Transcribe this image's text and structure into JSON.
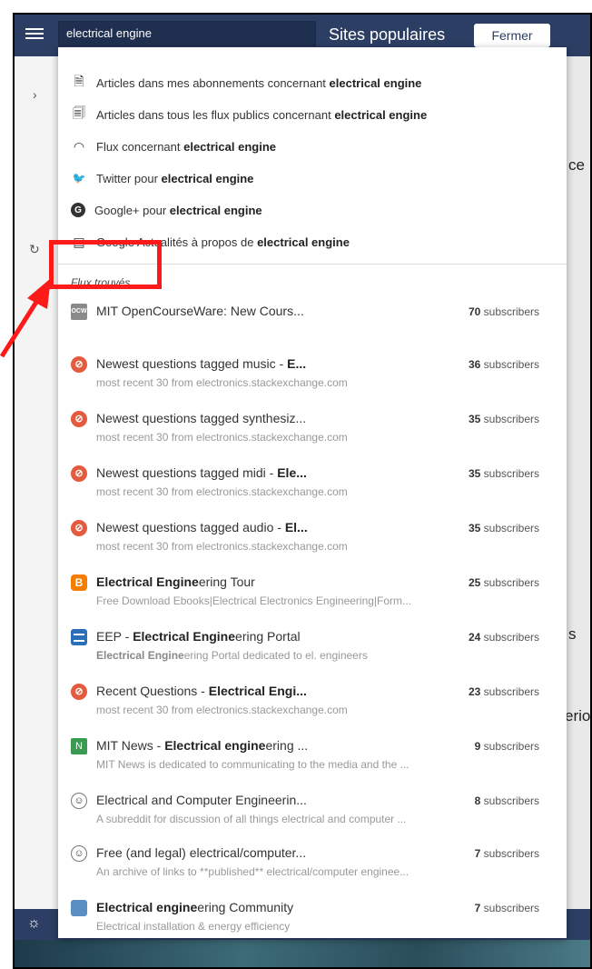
{
  "search": {
    "value": "electrical engine"
  },
  "header": {
    "sites_label": "Sites populaires",
    "close_label": "Fermer"
  },
  "suggestions": [
    {
      "icon": "document-icon",
      "prefix": "Articles dans mes abonnements concernant ",
      "term": "electrical engine"
    },
    {
      "icon": "documents-icon",
      "prefix": "Articles dans tous les flux publics concernant ",
      "term": "electrical engine"
    },
    {
      "icon": "rss-icon",
      "prefix": "Flux concernant ",
      "term": "electrical engine"
    },
    {
      "icon": "twitter-icon",
      "prefix": "Twitter pour ",
      "term": "electrical engine"
    },
    {
      "icon": "google-plus-icon",
      "prefix": "Google+ pour ",
      "term": "electrical engine"
    },
    {
      "icon": "news-icon",
      "prefix": "Google Actualités à propos de ",
      "term": "electrical engine"
    }
  ],
  "flux_label": "Flux trouvés",
  "feeds": [
    {
      "icon": "ocw-icon",
      "title_pre": "MIT OpenCourseWare: New Cours...",
      "title_bold": "",
      "title_post": "",
      "count": "70",
      "count_unit": " subscribers",
      "sub_bold": "",
      "sub": ""
    },
    {
      "icon": "stackexchange-icon",
      "title_pre": "Newest questions tagged music - ",
      "title_bold": "E...",
      "title_post": "",
      "count": "36",
      "count_unit": " subscribers",
      "sub_bold": "",
      "sub": "most recent 30 from electronics.stackexchange.com"
    },
    {
      "icon": "stackexchange-icon",
      "title_pre": "Newest questions tagged synthesiz...",
      "title_bold": "",
      "title_post": "",
      "count": "35",
      "count_unit": " subscribers",
      "sub_bold": "",
      "sub": "most recent 30 from electronics.stackexchange.com"
    },
    {
      "icon": "stackexchange-icon",
      "title_pre": "Newest questions tagged midi - ",
      "title_bold": "Ele...",
      "title_post": "",
      "count": "35",
      "count_unit": " subscribers",
      "sub_bold": "",
      "sub": "most recent 30 from electronics.stackexchange.com"
    },
    {
      "icon": "stackexchange-icon",
      "title_pre": "Newest questions tagged audio - ",
      "title_bold": "El...",
      "title_post": "",
      "count": "35",
      "count_unit": " subscribers",
      "sub_bold": "",
      "sub": "most recent 30 from electronics.stackexchange.com"
    },
    {
      "icon": "blogger-icon",
      "title_pre": "",
      "title_bold": "Electrical Engine",
      "title_post": "ering Tour",
      "count": "25",
      "count_unit": " subscribers",
      "sub_bold": "",
      "sub": "Free Download Ebooks|Electrical Electronics Engineering|Form..."
    },
    {
      "icon": "eep-icon",
      "title_pre": "EEP - ",
      "title_bold": "Electrical Engine",
      "title_post": "ering Portal",
      "count": "24",
      "count_unit": " subscribers",
      "sub_bold": "Electrical Engine",
      "sub": "ering Portal dedicated to el. engineers"
    },
    {
      "icon": "stackexchange-icon",
      "title_pre": "Recent Questions - ",
      "title_bold": "Electrical Engi...",
      "title_post": "",
      "count": "23",
      "count_unit": " subscribers",
      "sub_bold": "",
      "sub": "most recent 30 from electronics.stackexchange.com"
    },
    {
      "icon": "mit-news-icon",
      "title_pre": "MIT News - ",
      "title_bold": "Electrical engine",
      "title_post": "ering ...",
      "count": "9",
      "count_unit": " subscribers",
      "sub_bold": "",
      "sub": "MIT News is dedicated to communicating to the media and the ..."
    },
    {
      "icon": "reddit-icon",
      "title_pre": "Electrical and Computer Engineerin...",
      "title_bold": "",
      "title_post": "",
      "count": "8",
      "count_unit": " subscribers",
      "sub_bold": "",
      "sub": "A subreddit for discussion of all things electrical and computer ..."
    },
    {
      "icon": "reddit-icon",
      "title_pre": "Free (and legal) electrical/computer...",
      "title_bold": "",
      "title_post": "",
      "count": "7",
      "count_unit": " subscribers",
      "sub_bold": "",
      "sub": "An archive of links to **published** electrical/computer enginee..."
    },
    {
      "icon": "globe-icon",
      "title_pre": "",
      "title_bold": "Electrical engine",
      "title_post": "ering Community",
      "count": "7",
      "count_unit": " subscribers",
      "sub_bold": "",
      "sub": "Electrical installation & energy efficiency"
    }
  ],
  "background": {
    "right_text_1": "ce",
    "right_text_2": "s",
    "right_text_3": "erior"
  },
  "colors": {
    "nav": "#2c3e63",
    "annotation": "#ff1a1a",
    "stackexchange": "#e35a3f"
  }
}
